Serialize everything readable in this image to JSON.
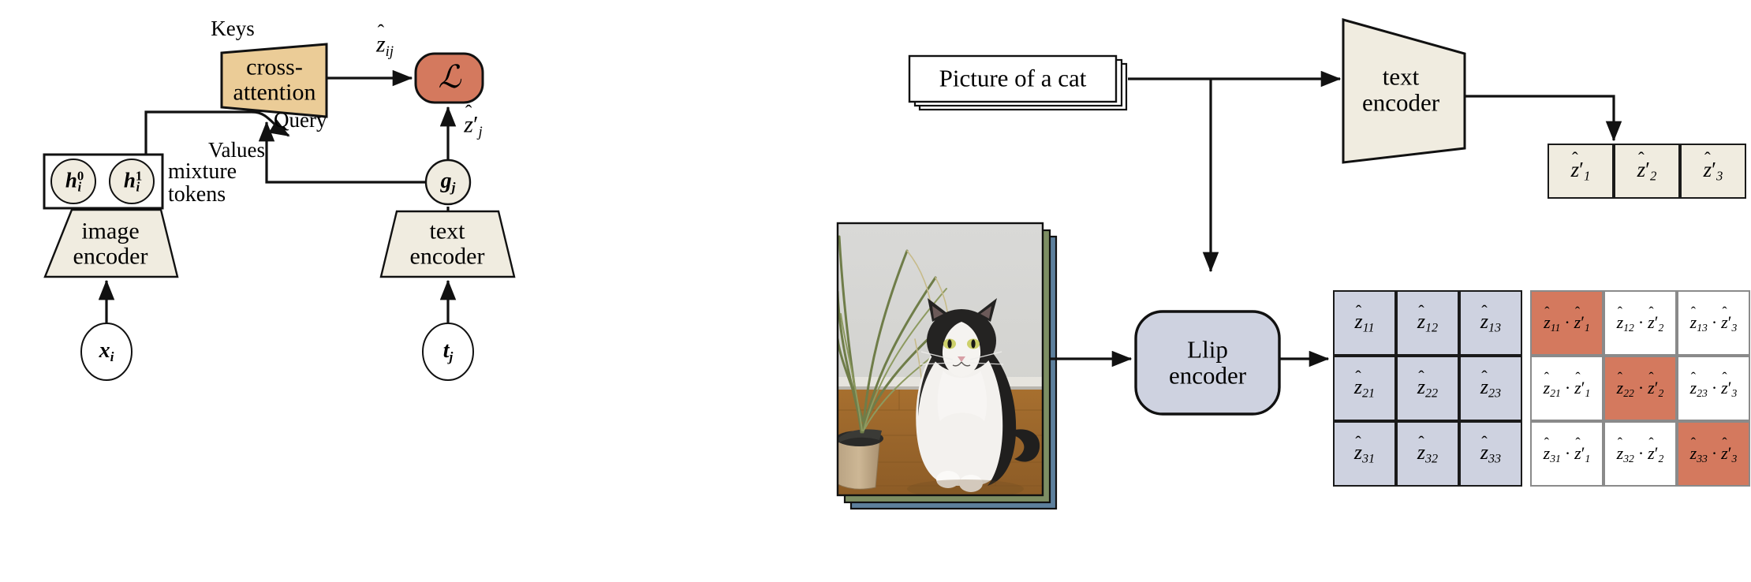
{
  "figure": {
    "title": "Llip architecture and contrastive matching diagram",
    "panels": [
      "left-architecture",
      "right-contrastive"
    ]
  },
  "colors": {
    "cross_attention_fill": "#ebcc97",
    "loss_fill": "#d4795e",
    "encoder_fill": "#f0ece0",
    "llip_fill": "#ced2e0",
    "z_matrix_fill": "#ced2e0",
    "zprime_fill": "#f0ece0",
    "highlight_fill": "#d4795e",
    "stroke": "#1a1a1a",
    "gray_stroke": "#8a8a8a"
  },
  "left": {
    "keys_label": "Keys",
    "values_label": "Values",
    "query_label": "Query",
    "cross_attention": "cross-\nattention",
    "cross_attention_line1": "cross-",
    "cross_attention_line2": "attention",
    "loss_symbol": "ℒ",
    "z_hat_ij": {
      "base": "z",
      "hat": "̂",
      "sub": "ij"
    },
    "z_hat_prime_j": {
      "base": "z",
      "hat": "̂",
      "prime": "′",
      "sub": "j"
    },
    "mixture_tokens_line1": "mixture",
    "mixture_tokens_line2": "tokens",
    "mixture_token_0": {
      "base": "h",
      "sub": "i",
      "sup": "0"
    },
    "mixture_token_1": {
      "base": "h",
      "sub": "i",
      "sup": "1"
    },
    "image_encoder_line1": "image",
    "image_encoder_line2": "encoder",
    "text_encoder_line1": "text",
    "text_encoder_line2": "encoder",
    "g_j": {
      "base": "g",
      "sub": "j"
    },
    "x_i": {
      "base": "x",
      "sub": "i"
    },
    "t_j": {
      "base": "t",
      "sub": "j"
    }
  },
  "right": {
    "caption_box": "Picture of a cat",
    "caption_box_stack_count": 3,
    "text_encoder_line1": "text",
    "text_encoder_line2": "encoder",
    "llip_encoder_line1": "Llip",
    "llip_encoder_line2": "encoder",
    "image_stack_count": 3,
    "image_alt": "photo of a black-and-white cat sitting on a wooden floor beside a potted plant",
    "zprime_row": [
      {
        "base": "z",
        "hat": "̂",
        "prime": "′",
        "sub": "1"
      },
      {
        "base": "z",
        "hat": "̂",
        "prime": "′",
        "sub": "2"
      },
      {
        "base": "z",
        "hat": "̂",
        "prime": "′",
        "sub": "3"
      }
    ],
    "z_matrix": [
      [
        {
          "base": "z",
          "hat": "̂",
          "sub": "11"
        },
        {
          "base": "z",
          "hat": "̂",
          "sub": "12"
        },
        {
          "base": "z",
          "hat": "̂",
          "sub": "13"
        }
      ],
      [
        {
          "base": "z",
          "hat": "̂",
          "sub": "21"
        },
        {
          "base": "z",
          "hat": "̂",
          "sub": "22"
        },
        {
          "base": "z",
          "hat": "̂",
          "sub": "23"
        }
      ],
      [
        {
          "base": "z",
          "hat": "̂",
          "sub": "31"
        },
        {
          "base": "z",
          "hat": "̂",
          "sub": "32"
        },
        {
          "base": "z",
          "hat": "̂",
          "sub": "33"
        }
      ]
    ],
    "dot_operator": "·",
    "dot_matrix": [
      [
        {
          "a_sub": "11",
          "b_sub": "1",
          "highlight": true
        },
        {
          "a_sub": "12",
          "b_sub": "2",
          "highlight": false
        },
        {
          "a_sub": "13",
          "b_sub": "3",
          "highlight": false
        }
      ],
      [
        {
          "a_sub": "21",
          "b_sub": "1",
          "highlight": false
        },
        {
          "a_sub": "22",
          "b_sub": "2",
          "highlight": true
        },
        {
          "a_sub": "23",
          "b_sub": "3",
          "highlight": false
        }
      ],
      [
        {
          "a_sub": "31",
          "b_sub": "1",
          "highlight": false
        },
        {
          "a_sub": "32",
          "b_sub": "2",
          "highlight": false
        },
        {
          "a_sub": "33",
          "b_sub": "3",
          "highlight": true
        }
      ]
    ]
  }
}
